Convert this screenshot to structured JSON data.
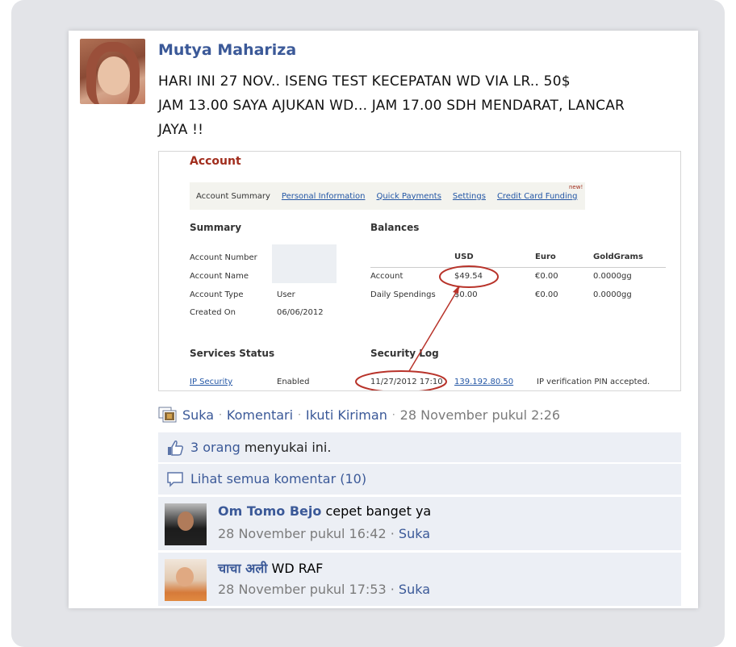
{
  "post": {
    "author": "Mutya Mahariza",
    "text_line1": "HARI INI 27 NOV.. ISENG TEST KECEPATAN WD VIA LR.. 50$",
    "text_line2": "JAM 13.00 SAYA AJUKAN WD... JAM 17.00 SDH MENDARAT, LANCAR",
    "text_line3": "JAYA !!"
  },
  "screenshot": {
    "title": "Account",
    "tabs": [
      "Account Summary",
      "Personal Information",
      "Quick Payments",
      "Settings",
      "Credit Card Funding"
    ],
    "new_badge": "new!",
    "summary_title": "Summary",
    "summary_rows": [
      {
        "label": "Account Number",
        "value": ""
      },
      {
        "label": "Account Name",
        "value": ""
      },
      {
        "label": "Account Type",
        "value": "User"
      },
      {
        "label": "Created On",
        "value": "06/06/2012"
      }
    ],
    "balances_title": "Balances",
    "balances_headers": [
      "USD",
      "Euro",
      "GoldGrams"
    ],
    "balances_rows": [
      {
        "label": "Account",
        "usd": "$49.54",
        "euro": "€0.00",
        "gold": "0.0000gg"
      },
      {
        "label": "Daily Spendings",
        "usd": "$0.00",
        "euro": "€0.00",
        "gold": "0.0000gg"
      }
    ],
    "services_title": "Services Status",
    "service_name": "IP Security",
    "service_status": "Enabled",
    "security_title": "Security Log",
    "log_date": "11/27/2012 17:10",
    "log_ip": "139.192.80.50",
    "log_message": "IP verification PIN accepted.",
    "highlight_color": "#b8332a"
  },
  "actions": {
    "like": "Suka",
    "comment": "Komentari",
    "follow": "Ikuti Kiriman",
    "timestamp": "28 November pukul 2:26"
  },
  "likes": {
    "count_link": "3 orang",
    "suffix": " menyukai ini."
  },
  "view_comments": "Lihat semua komentar (10)",
  "comments": [
    {
      "name": "Om Tomo Bejo",
      "text": " cepet banget ya",
      "time": "28 November pukul 16:42",
      "like": "Suka"
    },
    {
      "name": "चाचा अली",
      "text": " WD RAF",
      "time": "28 November pukul 17:53",
      "like": "Suka"
    }
  ],
  "colors": {
    "link": "#3b5998",
    "meta": "#7b7b7b",
    "row_bg": "#eceff5"
  }
}
